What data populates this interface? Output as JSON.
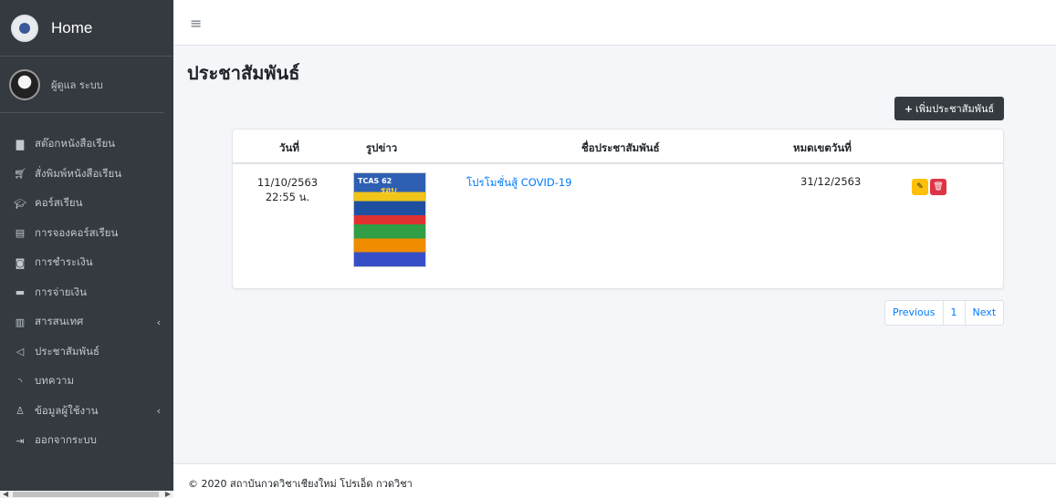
{
  "brand": {
    "title": "Home"
  },
  "user": {
    "name": "ผู้ดูแล ระบบ"
  },
  "sidebar": {
    "items": [
      {
        "label": "สต๊อกหนังสือเรียน",
        "icon": "book-icon"
      },
      {
        "label": "สั่งพิมพ์หนังสือเรียน",
        "icon": "cart-icon"
      },
      {
        "label": "คอร์สเรียน",
        "icon": "graduation-cap-icon"
      },
      {
        "label": "การจองคอร์สเรียน",
        "icon": "document-icon"
      },
      {
        "label": "การชำระเงิน",
        "icon": "money-icon"
      },
      {
        "label": "การจ่ายเงิน",
        "icon": "credit-card-icon"
      },
      {
        "label": "สารสนเทศ",
        "icon": "bar-chart-icon",
        "has_submenu": true
      },
      {
        "label": "ประชาสัมพันธ์",
        "icon": "bullhorn-icon"
      },
      {
        "label": "บทความ",
        "icon": "rss-icon"
      },
      {
        "label": "ข้อมูลผู้ใช้งาน",
        "icon": "user-icon",
        "has_submenu": true
      },
      {
        "label": "ออกจากระบบ",
        "icon": "sign-out-icon"
      }
    ]
  },
  "page": {
    "title": "ประชาสัมพันธ์",
    "add_button": "เพิ่มประชาสัมพันธ์"
  },
  "table": {
    "headers": {
      "date": "วันที่",
      "image": "รูปข่าว",
      "name": "ชื่อประชาสัมพันธ์",
      "expire": "หมดเขตวันที่"
    },
    "rows": [
      {
        "date": "11/10/2563",
        "time": "22:55 น.",
        "image_text": "TCAS 62",
        "image_tag": "รอบ",
        "name": "โปรโมชั่นสู้ COVID-19",
        "expire": "31/12/2563"
      }
    ]
  },
  "pagination": {
    "previous": "Previous",
    "page": "1",
    "next": "Next"
  },
  "footer": {
    "text": "© 2020 สถาบันกวดวิชาเชียงใหม่ โปรเอ็ด กวดวิชา"
  },
  "colors": {
    "sidebar": "#343a40",
    "link": "#007bff",
    "edit": "#ffc107",
    "delete": "#dc3545",
    "content_bg": "#f4f6f9"
  }
}
